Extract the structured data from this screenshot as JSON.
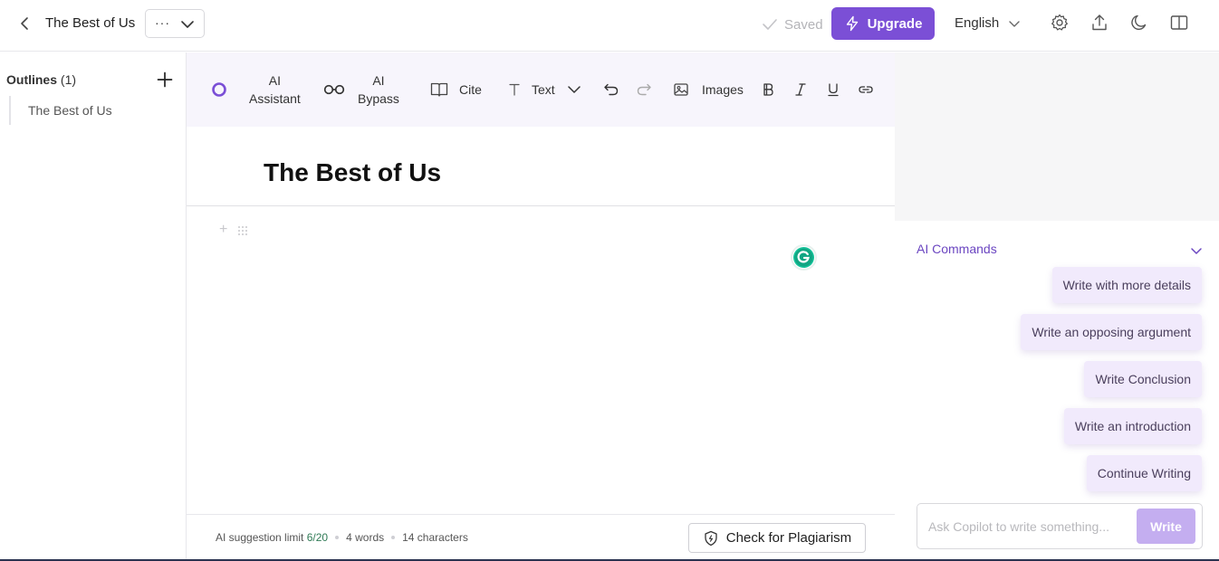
{
  "header": {
    "doc_title": "The Best of Us",
    "menu_dots": "···",
    "saved_label": "Saved",
    "upgrade_label": "Upgrade",
    "language": "English"
  },
  "sidebar": {
    "outlines_label": "Outlines",
    "outlines_count": "(1)",
    "items": [
      {
        "label": "The Best of Us"
      }
    ]
  },
  "toolbar": {
    "ai_assistant": [
      "AI",
      "Assistant"
    ],
    "ai_bypass": [
      "AI",
      "Bypass"
    ],
    "cite": "Cite",
    "text": "Text",
    "images": "Images"
  },
  "editor": {
    "heading": "The Best of Us"
  },
  "footer": {
    "limit_label": "AI suggestion limit",
    "limit_value": "6/20",
    "words": "4 words",
    "characters": "14 characters",
    "plagiarism_label": "Check for Plagiarism"
  },
  "right_panel": {
    "ai_commands_title": "AI Commands",
    "commands": [
      "Write with more details",
      "Write an opposing argument",
      "Write Conclusion",
      "Write an introduction",
      "Continue Writing"
    ],
    "copilot_placeholder": "Ask Copilot to write something...",
    "write_label": "Write"
  },
  "colors": {
    "accent": "#7b4fd6",
    "toolbar_bg": "#f7f5fc",
    "command_bg": "#f1eafc",
    "write_button_disabled": "#c4aef0"
  }
}
